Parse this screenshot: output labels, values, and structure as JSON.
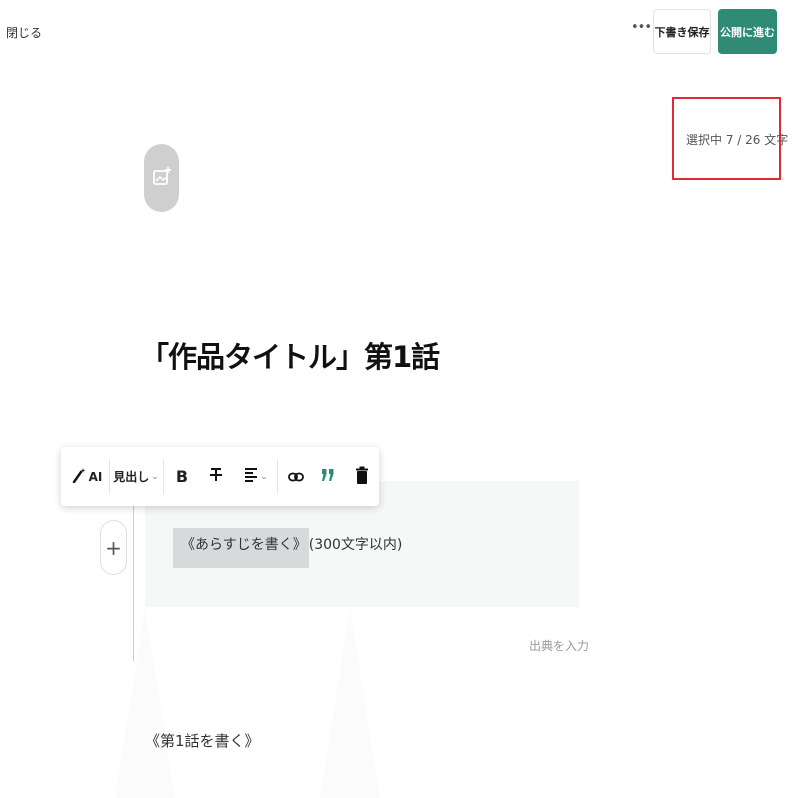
{
  "header": {
    "close_label": "閉じる",
    "more_label": "•••",
    "draft_label": "下書き保存",
    "publish_label": "公開に進む"
  },
  "selection_counter": {
    "text": "選択中 7 / 26 文字"
  },
  "title": "「作品タイトル」第1話",
  "toolbar": {
    "ai_label": "AI",
    "heading_label": "見出し",
    "heading_chevron": "⌄",
    "bold_label": "B",
    "align_chevron": "⌄"
  },
  "synopsis": {
    "selected_text": "《あらすじを書く》",
    "rest_text": "(300文字以内)"
  },
  "source_placeholder": "出典を入力",
  "episode_body": "《第1話を書く》",
  "colors": {
    "accent": "#2f8a76",
    "highlight_border": "#e02b36",
    "quote_icon": "#2f8a76"
  },
  "icons": [
    "ai-wand-icon",
    "bold-icon",
    "strikethrough-icon",
    "align-icon",
    "link-icon",
    "quote-icon",
    "trash-icon",
    "add-image-icon",
    "plus-icon"
  ]
}
